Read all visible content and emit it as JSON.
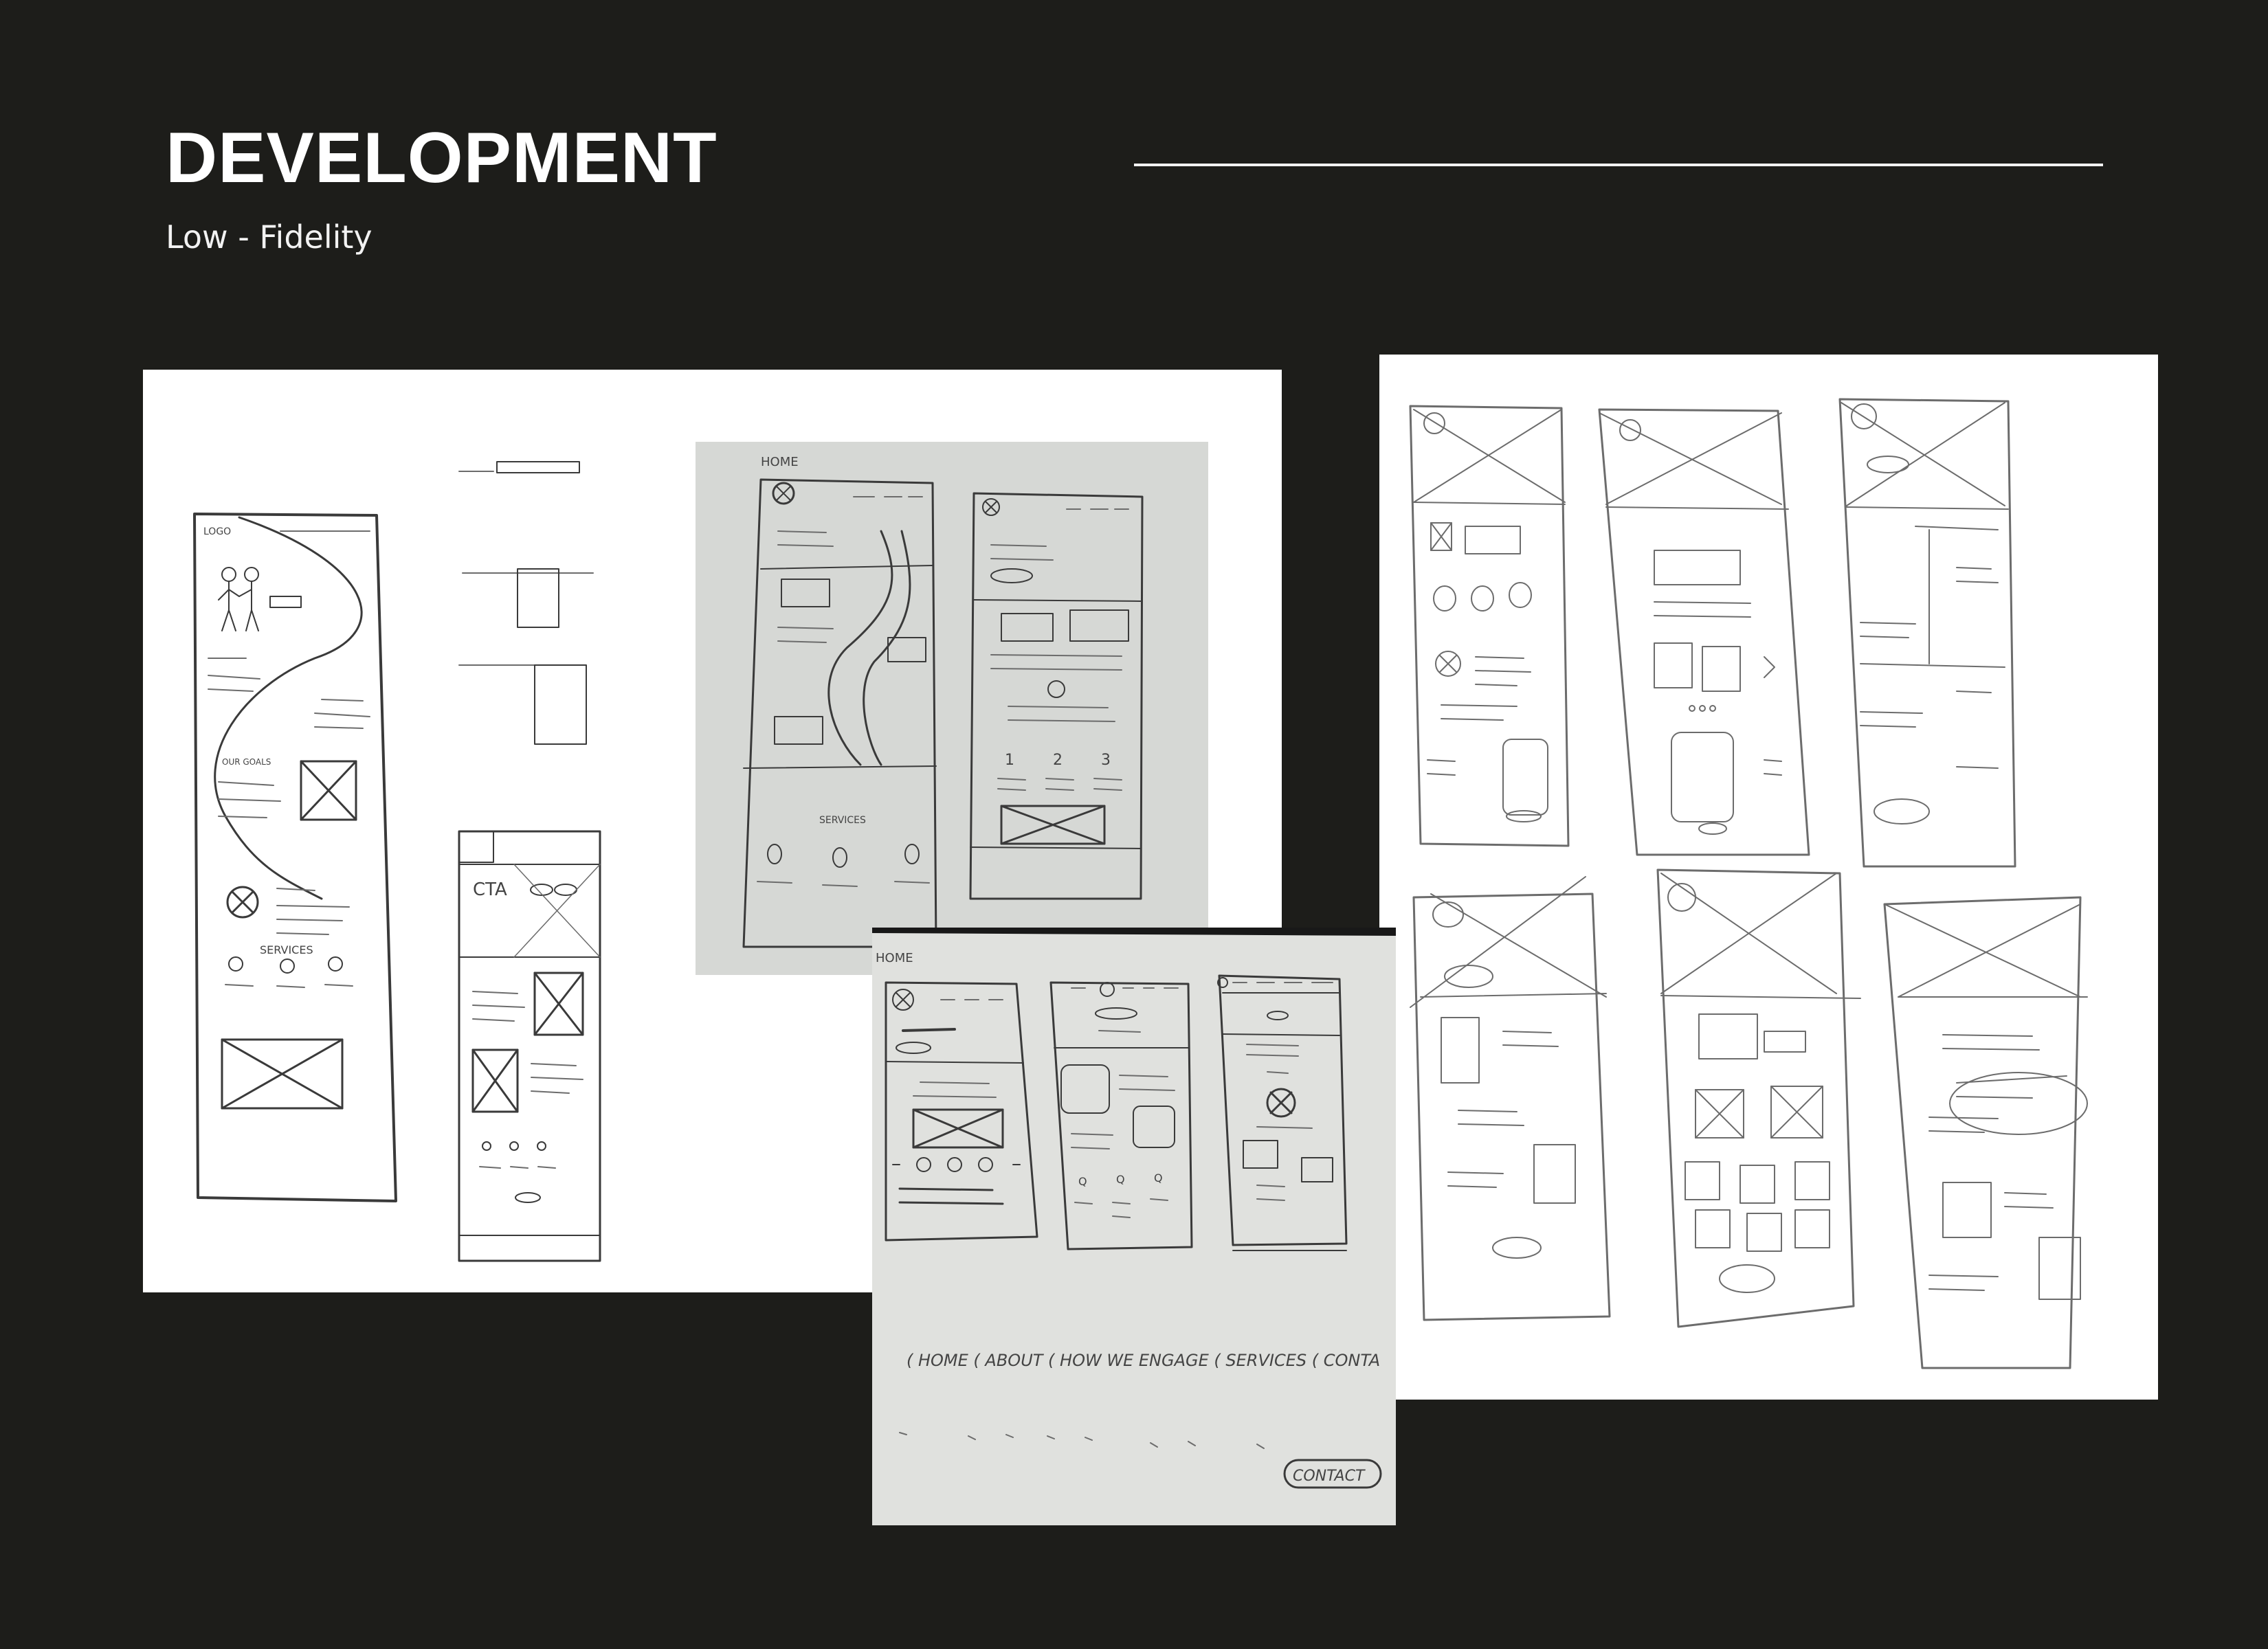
{
  "header": {
    "title": "DEVELOPMENT",
    "subtitle": "Low - Fidelity"
  },
  "sketches": {
    "left_sheet": {
      "label_logo": "LOGO",
      "label_services": "SERVICES",
      "label_cta": "CTA",
      "label_our_goals": "OUR GOALS"
    },
    "gray_photo": {
      "label_home": "HOME",
      "label_services": "SERVICES",
      "label_steps": [
        "1",
        "2",
        "3"
      ]
    },
    "bottom_photo": {
      "label_home": "HOME",
      "nav_text": "( HOME ( ABOUT ( HOW WE ENGAGE ( SERVICES ( CONTA",
      "label_contact": "CONTACT"
    }
  },
  "colors": {
    "background": "#1d1d1a",
    "text": "#ffffff",
    "paper": "#ffffff",
    "pencil": "#3a3a3a"
  }
}
